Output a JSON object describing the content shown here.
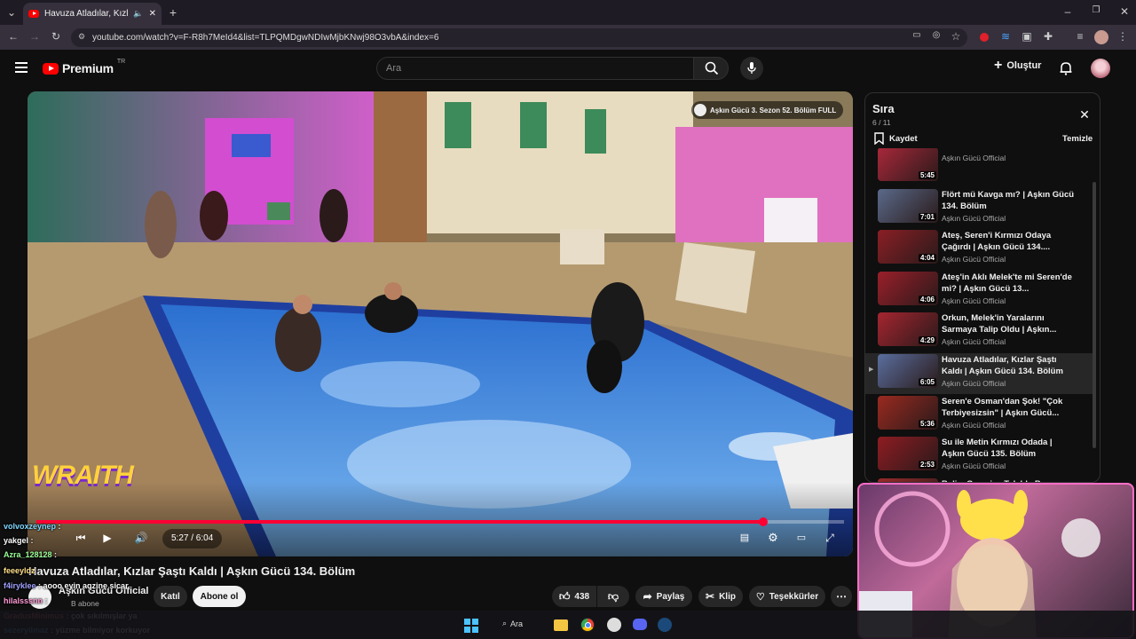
{
  "browser": {
    "tab_title": "Havuza Atladılar, Kızlar Şaşt",
    "url": "youtube.com/watch?v=F-R8h7MeId4&list=TLPQMDgwNDIwMjbKNwj98O3vbA&index=6"
  },
  "header": {
    "logo": "Premium",
    "logo_region": "TR",
    "search_placeholder": "Ara",
    "create_label": "Oluştur"
  },
  "video": {
    "title": "Havuza Atladılar, Kızlar Şaştı Kaldı | Aşkın Gücü 134. Bölüm",
    "time": "5:27 / 6:04",
    "progress_fraction": 0.9,
    "overlay_chip": "Aşkın Gücü 3. Sezon 52. Bölüm FULL",
    "watermark": "WRAITH"
  },
  "channel": {
    "name": "Aşkın Gücü Official",
    "subs": "B abone",
    "join": "Katıl",
    "subscribe": "Abone ol"
  },
  "actions": {
    "likes": "438",
    "share": "Paylaş",
    "clip": "Klip",
    "thanks": "Teşekkürler"
  },
  "queue": {
    "title": "Sıra",
    "position": "6 / 11",
    "save": "Kaydet",
    "clear": "Temizle",
    "items": [
      {
        "title": "",
        "channel": "Aşkın Gücü Official",
        "duration": "5:45",
        "color": "#a8283a"
      },
      {
        "title": "Flört mü Kavga mı? | Aşkın Gücü 134. Bölüm",
        "channel": "Aşkın Gücü Official",
        "duration": "7:01",
        "color": "#5a6a8a"
      },
      {
        "title": "Ateş, Seren'i Kırmızı Odaya Çağırdı | Aşkın Gücü 134....",
        "channel": "Aşkın Gücü Official",
        "duration": "4:04",
        "color": "#8a1f25"
      },
      {
        "title": "Ateş'in Aklı Melek'te mi Seren'de mi? | Aşkın Gücü 13...",
        "channel": "Aşkın Gücü Official",
        "duration": "4:06",
        "color": "#9a1f2a"
      },
      {
        "title": "Orkun, Melek'in Yaralarını Sarmaya Talip Oldu | Aşkın...",
        "channel": "Aşkın Gücü Official",
        "duration": "4:29",
        "color": "#a52530"
      },
      {
        "title": "Havuza Atladılar, Kızlar Şaştı Kaldı | Aşkın Gücü 134. Bölüm",
        "channel": "Aşkın Gücü Official",
        "duration": "6:05",
        "color": "#5a6e9e"
      },
      {
        "title": "Seren'e Osman'dan Şok! \"Çok Terbiyesizsin\" | Aşkın Gücü...",
        "channel": "Aşkın Gücü Official",
        "duration": "5:36",
        "color": "#9a2a20"
      },
      {
        "title": "Su ile Metin Kırmızı Odada | Aşkın Gücü 135. Bölüm",
        "channel": "Aşkın Gücü Official",
        "duration": "2:53",
        "color": "#8e1c22"
      },
      {
        "title": "Belis, Geçmişe Takıldı, Barış Tedirgin! | Aşkın Gücü 135....",
        "channel": "",
        "duration": "",
        "color": "#9a2a2a"
      }
    ]
  },
  "chat": [
    {
      "user": "volvoxzeynep",
      "msg": "",
      "color": "#7fd7ff"
    },
    {
      "user": "yakgel",
      "msg": "",
      "color": "#ffffff"
    },
    {
      "user": "Azra_128128",
      "msg": "",
      "color": "#9aff9a"
    },
    {
      "user": "feeeyldz",
      "msg": "",
      "color": "#ffe08a"
    },
    {
      "user": "f4iryklee",
      "msg": "aooo eyin aqzine sicar",
      "color": "#a0a0ff"
    },
    {
      "user": "hilalsssnn",
      "msg": "",
      "color": "#ff9ad5"
    },
    {
      "user": "GradusMinimus",
      "msg": "çok sıkılmışlar ya",
      "color": "#ff6b6b"
    },
    {
      "user": "sezeryilmaz",
      "msg": "yüzme bilmiyor korkuyor",
      "color": "#66aaff"
    }
  ],
  "taskbar": {
    "search": "Ara"
  },
  "colors": {
    "accent": "#ff0033",
    "bg": "#0f0f0f"
  }
}
